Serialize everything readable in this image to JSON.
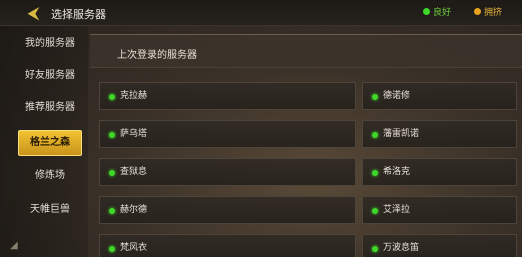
{
  "header": {
    "back_icon": "back-arrow-icon",
    "title": "选择服务器",
    "legend": [
      {
        "label": "良好",
        "color": "#3fd82a"
      },
      {
        "label": "拥挤",
        "color": "#e8a21e"
      }
    ]
  },
  "sidebar": {
    "items": [
      {
        "label": "我的服务器",
        "active": false
      },
      {
        "label": "好友服务器",
        "active": false
      },
      {
        "label": "推荐服务器",
        "active": false
      },
      {
        "label": "格兰之森",
        "active": true
      },
      {
        "label": "修炼场",
        "active": false
      },
      {
        "label": "天帷巨兽",
        "active": false
      }
    ]
  },
  "main": {
    "section_title": "上次登录的服务器",
    "servers_left": [
      {
        "name": "克拉赫",
        "status": "good"
      },
      {
        "name": "萨乌塔",
        "status": "good"
      },
      {
        "name": "查狱息",
        "status": "good"
      },
      {
        "name": "赫尔德",
        "status": "good"
      },
      {
        "name": "梵风衣",
        "status": "good"
      }
    ],
    "servers_right": [
      {
        "name": "德诺修",
        "status": "good"
      },
      {
        "name": "藩雷凯诺",
        "status": "good"
      },
      {
        "name": "希洛克",
        "status": "good"
      },
      {
        "name": "艾泽拉",
        "status": "good"
      },
      {
        "name": "万波息笛",
        "status": "good"
      }
    ]
  }
}
